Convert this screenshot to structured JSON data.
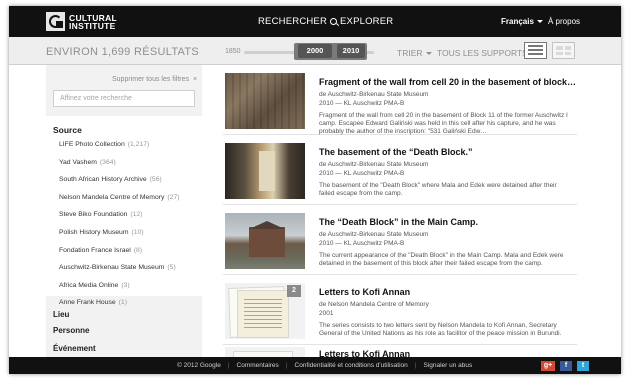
{
  "header": {
    "logo_line1": "CULTURAL",
    "logo_line2": "INSTITUTE",
    "nav_search": "RECHERCHER",
    "nav_explore": "EXPLORER",
    "language": "Français",
    "about": "À propos"
  },
  "toolbar": {
    "results_count": "ENVIRON 1,699 RÉSULTATS",
    "slider_min": "1850",
    "slider_from": "2000",
    "slider_to": "2010",
    "sort_label": "TRIER",
    "supports_label": "TOUS LES SUPPORTS"
  },
  "sidebar": {
    "clear_filters": "Supprimer tous les filtres",
    "clear_x": "×",
    "search_placeholder": "Affinez votre recherche",
    "source_title": "Source",
    "sources": [
      {
        "name": "LIFE Photo Collection",
        "count": "(1,217)"
      },
      {
        "name": "Yad Vashem",
        "count": "(364)"
      },
      {
        "name": "South African History Archive",
        "count": "(56)"
      },
      {
        "name": "Nelson Mandela Centre of Memory",
        "count": "(27)"
      },
      {
        "name": "Steve Biko Foundation",
        "count": "(12)"
      },
      {
        "name": "Polish History Museum",
        "count": "(10)"
      },
      {
        "name": "Fondation France Israel",
        "count": "(8)"
      },
      {
        "name": "Auschwitz-Birkenau State Museum",
        "count": "(5)"
      },
      {
        "name": "Africa Media Online",
        "count": "(3)"
      },
      {
        "name": "Anne Frank House",
        "count": "(1)"
      }
    ],
    "facet_lieu": "Lieu",
    "facet_personne": "Personne",
    "facet_evenement": "Événement"
  },
  "results": [
    {
      "title": "Fragment of the wall from cell 20 in the basement of block…",
      "source": "de Auschwitz-Birkenau State Museum",
      "date_ref": "2010 — KL Auschwitz PMA-B",
      "description": "Fragment of the wall from cell 20 in the basement of Block 11 of the former Auschwitz I camp. Escapee Edward Galiński was held in this cell after his capture, and he was probably the author of the inscription: \"531 Galiński Edw…"
    },
    {
      "title": "The basement of the “Death Block.”",
      "source": "de Auschwitz-Birkenau State Museum",
      "date_ref": "2010 — KL Auschwitz PMA-B",
      "description": "The basement of the \"Death Block\" where Mala and Edek were detained after their failed escape from the camp."
    },
    {
      "title": "The “Death Block” in the Main Camp.",
      "source": "de Auschwitz-Birkenau State Museum",
      "date_ref": "2010 — KL Auschwitz PMA-B",
      "description": "The current appearance of the \"Death Block\" in the Main Camp. Mala and Edek were detained in the basement of this block after their failed escape from the camp."
    },
    {
      "title": "Letters to Kofi Annan",
      "source": "de Nelson Mandela Centre of Memory",
      "date_ref": "2001",
      "description": "The series consists to two letters sent by Nelson Mandela to Kofi Annan, Secretary General of the United Nations as his role as facilitor of the peace mission in Burundi.",
      "badge": "2"
    },
    {
      "title": "Letters to Kofi Annan"
    }
  ],
  "footer": {
    "copyright": "© 2012 Google",
    "comments": "Commentaires",
    "privacy": "Confidentialité et conditions d'utilisation",
    "report": "Signaler un abus",
    "social_g": "g+",
    "social_f": "f",
    "social_t": "t"
  }
}
